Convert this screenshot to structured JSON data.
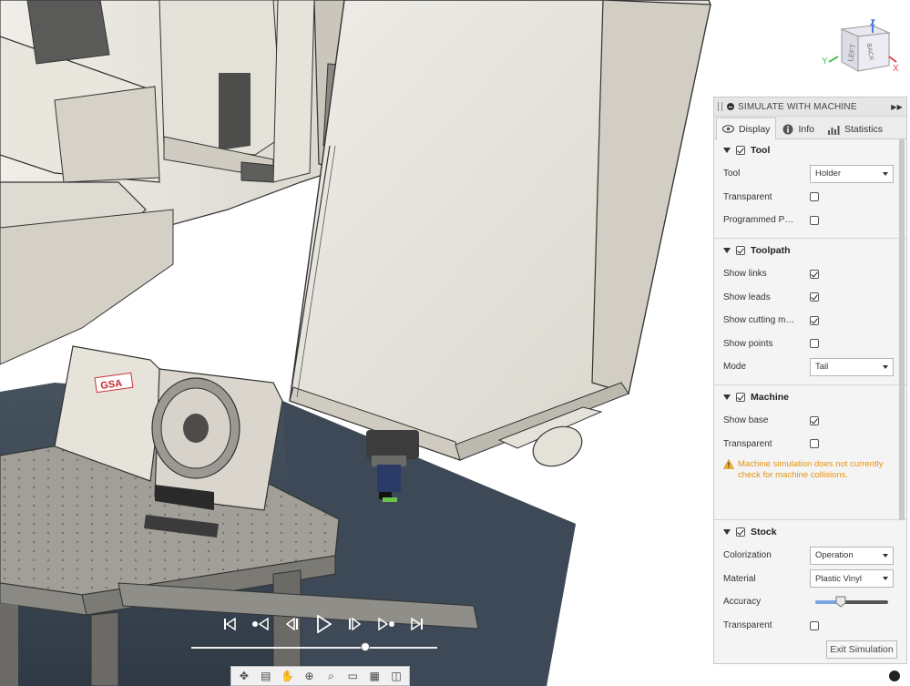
{
  "view_cube": {
    "face_top": "Z",
    "face_left": "LEFT",
    "face_front": "BACK",
    "axis_x": "X",
    "axis_y": "Y",
    "axis_z": "Z"
  },
  "machine_brand": "GSA",
  "panel": {
    "title": "SIMULATE WITH MACHINE",
    "tabs": [
      {
        "label": "Display",
        "icon": "eye-icon",
        "active": true
      },
      {
        "label": "Info",
        "icon": "info-icon",
        "active": false
      },
      {
        "label": "Statistics",
        "icon": "bar-chart-icon",
        "active": false
      }
    ],
    "tool": {
      "heading": "Tool",
      "enabled": true,
      "tool_label": "Tool",
      "tool_value": "Holder",
      "transparent_label": "Transparent",
      "transparent": false,
      "programmed_point_label": "Programmed Point",
      "programmed_point": false
    },
    "toolpath": {
      "heading": "Toolpath",
      "enabled": true,
      "show_links_label": "Show links",
      "show_links": true,
      "show_leads_label": "Show leads",
      "show_leads": true,
      "show_cutting_label": "Show cutting mo...",
      "show_cutting": true,
      "show_points_label": "Show points",
      "show_points": false,
      "mode_label": "Mode",
      "mode_value": "Tail"
    },
    "machine": {
      "heading": "Machine",
      "enabled": true,
      "show_base_label": "Show base",
      "show_base": true,
      "transparent_label": "Transparent",
      "transparent": false,
      "warning": "Machine simulation does not currently check for machine collisions."
    },
    "stock": {
      "heading": "Stock",
      "enabled": true,
      "colorization_label": "Colorization",
      "colorization_value": "Operation",
      "material_label": "Material",
      "material_value": "Plastic Vinyl",
      "accuracy_label": "Accuracy",
      "accuracy_level": 0.35,
      "transparent_label": "Transparent",
      "transparent": false
    },
    "exit_label": "Exit Simulation"
  },
  "playback": {
    "buttons": [
      "skip-to-start-icon",
      "previous-operation-icon",
      "step-back-icon",
      "play-icon",
      "step-forward-icon",
      "next-operation-icon",
      "skip-to-end-icon"
    ],
    "timeline_progress": 0.72
  },
  "nav_toolbar": [
    "orbit-icon",
    "look-at-icon",
    "pan-icon",
    "zoom-icon",
    "fit-icon",
    "display-settings-icon",
    "grid-icon",
    "viewports-icon"
  ],
  "colors": {
    "accent": "#7aa7e4",
    "warning": "#e8930c",
    "machine_body": "#e7e4dc",
    "table": "#9b9a94",
    "floor": "#3f4d5c"
  }
}
